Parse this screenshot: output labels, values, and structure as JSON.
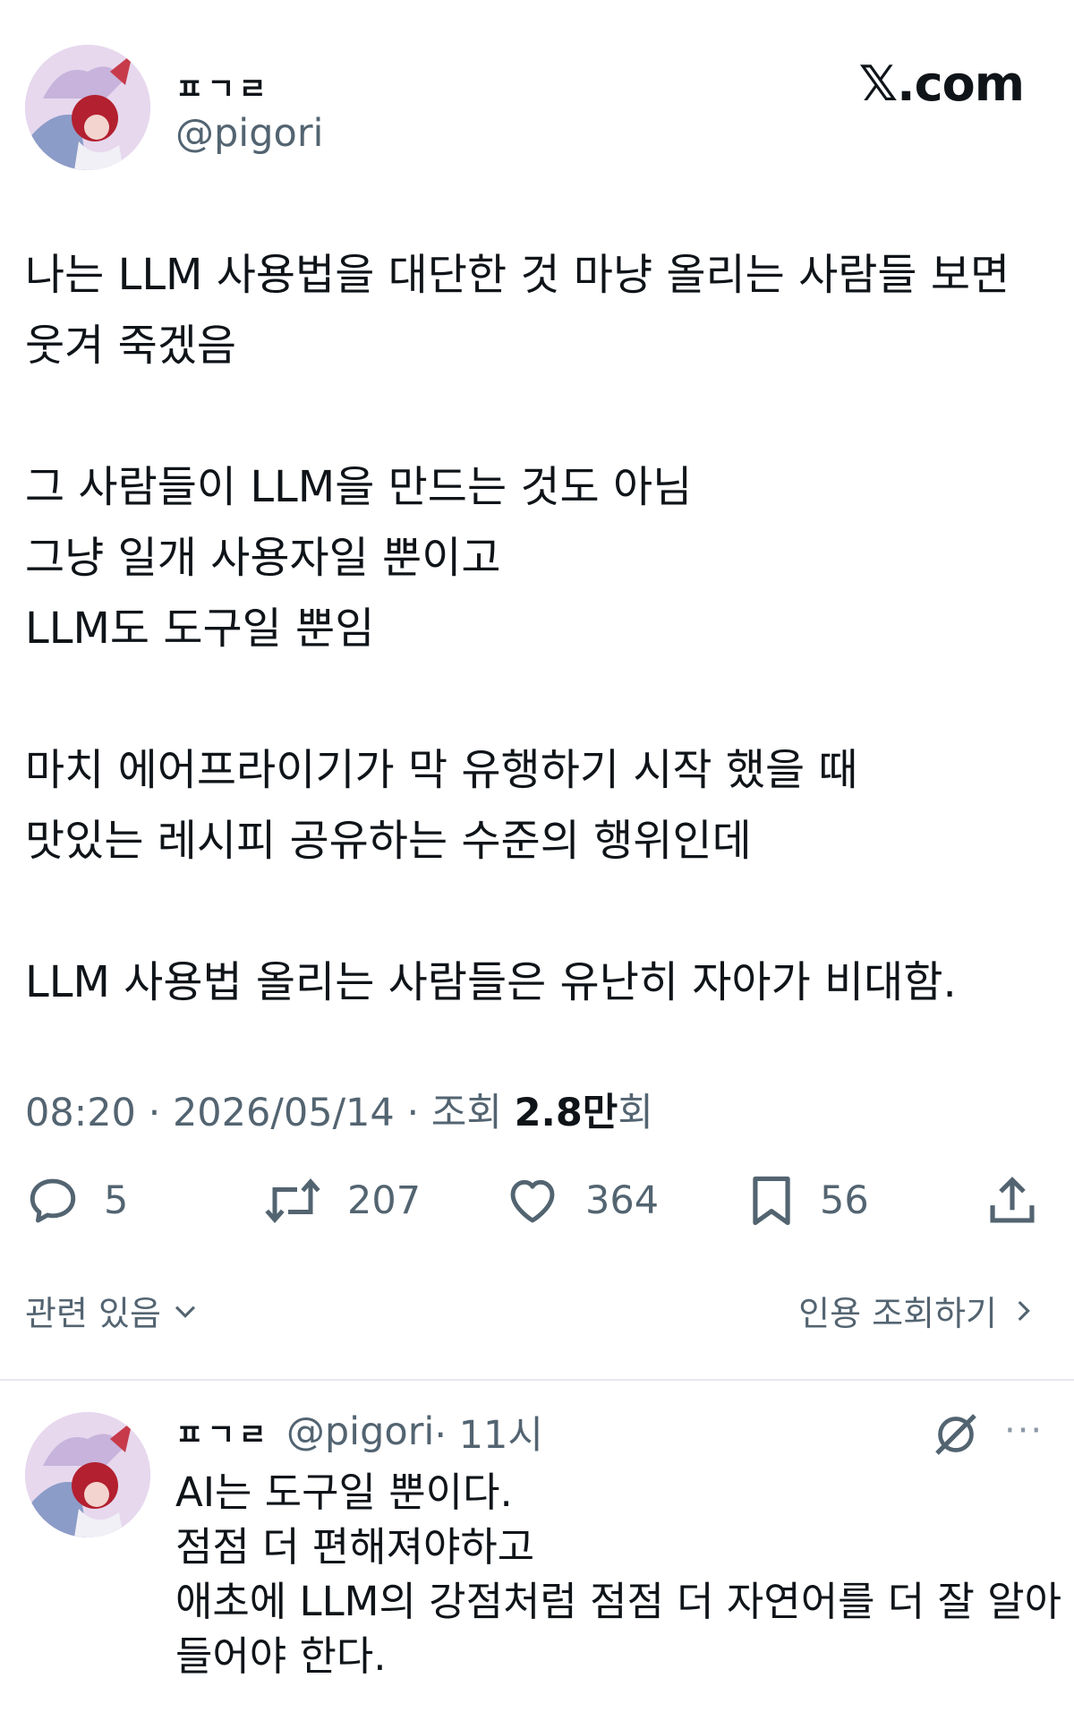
{
  "author": {
    "display_name": "ㅍㄱㄹ",
    "handle": "@pigori"
  },
  "brand": {
    "logo_text": "𝕏.com"
  },
  "tweet": {
    "paragraphs": [
      "나는 LLM 사용법을 대단한 것 마냥 올리는 사람들 보면\n웃겨 죽겠음",
      "그 사람들이 LLM을 만드는 것도 아님\n그냥 일개 사용자일 뿐이고\nLLM도 도구일 뿐임",
      "마치 에어프라이기가 막 유행하기 시작 했을 때\n맛있는 레시피 공유하는 수준의 행위인데",
      "LLM 사용법 올리는 사람들은 유난히 자아가 비대함."
    ],
    "time": "08:20",
    "date": "2026/05/14",
    "separator": " · ",
    "views_label": "조회",
    "views_count": "2.8만",
    "views_suffix": "회"
  },
  "actions": {
    "reply_icon": "reply-icon",
    "replies": "5",
    "retweet_icon": "retweet-icon",
    "retweets": "207",
    "like_icon": "heart-icon",
    "likes": "364",
    "bookmark_icon": "bookmark-icon",
    "bookmarks": "56",
    "share_icon": "share-icon"
  },
  "related": {
    "label": "관련 있음"
  },
  "quotes": {
    "label": "인용 조회하기"
  },
  "reply": {
    "display_name": "ㅍㄱㄹ",
    "handle": "@pigori",
    "time": "· 11시",
    "body": "AI는 도구일 뿐이다.\n점점 더 편해져야하고\n애초에 LLM의 강점처럼 점점 더 자연어를 더 잘 알아\n들어야 한다.",
    "more": "···"
  },
  "colors": {
    "text_primary": "#0f1419",
    "text_secondary": "#536471",
    "divider": "#e6e9ec"
  }
}
